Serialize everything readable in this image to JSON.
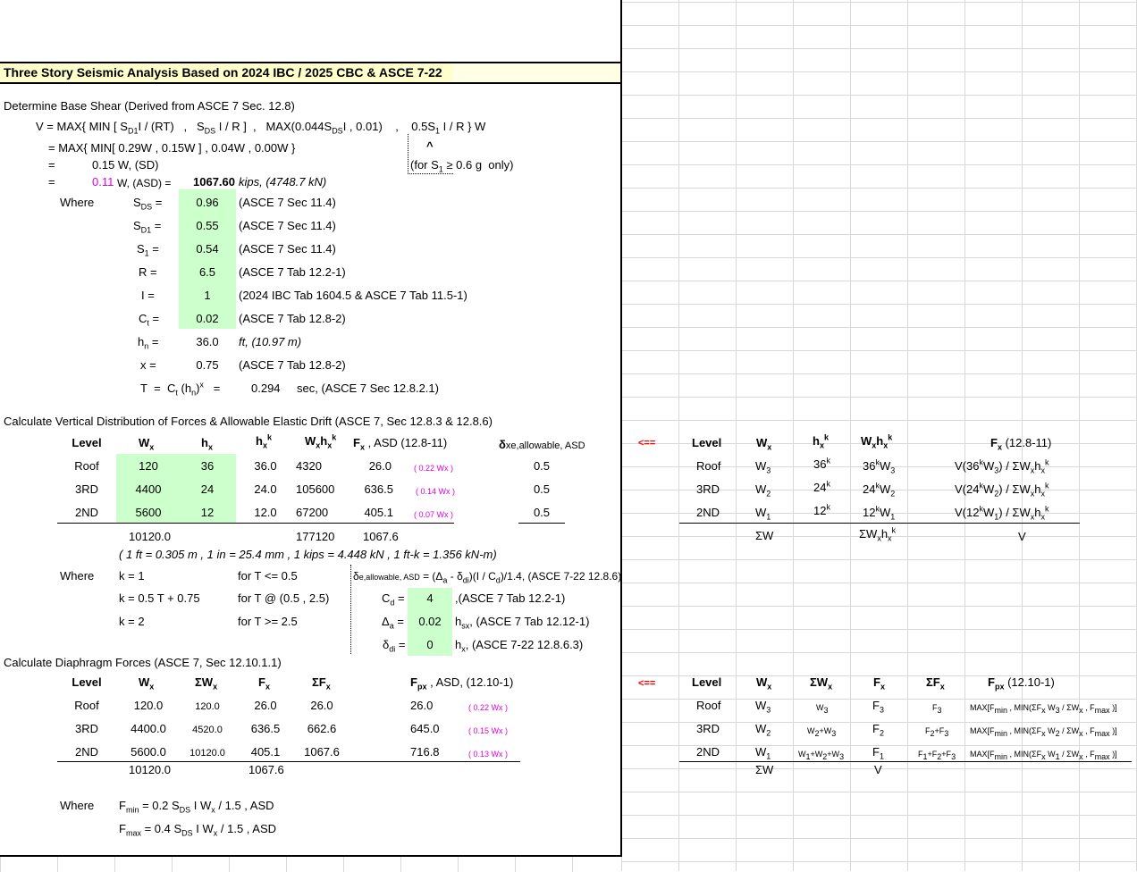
{
  "title": "Three Story Seismic Analysis Based on 2024 IBC / 2025 CBC & ASCE 7-22",
  "base_shear": {
    "heading": "Determine Base Shear (Derived from ASCE 7 Sec. 12.8)",
    "line1_prefix": "V = MAX{ MIN [ S",
    "line2": "= MAX{ MIN[ 0.29W  ,  0.15W ] ,  0.04W  ,  0.00W }",
    "caret": "^",
    "for_s1": "(for S",
    "for_s1_tail": " ≥ 0.6 g  only)",
    "eq": "=",
    "sd_value": "0.15 W, (SD)",
    "asd_coef": "0.11",
    "asd_label": "W, (ASD) =",
    "asd_value": "1067.60",
    "asd_units": "kips, (4748.7 kN)",
    "where": "Where"
  },
  "params": [
    {
      "sym": "S",
      "sub": "DS",
      "value": "0.96",
      "ref": "(ASCE 7 Sec 11.4)"
    },
    {
      "sym": "S",
      "sub": "D1",
      "value": "0.55",
      "ref": "(ASCE 7 Sec 11.4)"
    },
    {
      "sym": "S",
      "sub": "1",
      "value": "0.54",
      "ref": "(ASCE 7 Sec 11.4)"
    },
    {
      "sym": "R",
      "sub": "",
      "value": "6.5",
      "ref": "(ASCE 7 Tab 12.2-1)"
    },
    {
      "sym": "I",
      "sub": "",
      "value": "1",
      "ref": "(2024 IBC Tab 1604.5 & ASCE 7 Tab 11.5-1)"
    },
    {
      "sym": "C",
      "sub": "t",
      "value": "0.02",
      "ref": "(ASCE 7 Tab 12.8-2)"
    },
    {
      "sym": "h",
      "sub": "n",
      "value": "36.0",
      "ref": "ft, (10.97 m)"
    },
    {
      "sym": "x",
      "sub": "",
      "value": "0.75",
      "ref": "(ASCE 7 Tab 12.8-2)"
    }
  ],
  "period": {
    "label": "T  =  C",
    "value": "0.294",
    "ref": "sec, (ASCE 7 Sec 12.8.2.1)"
  },
  "vertical": {
    "heading": "Calculate Vertical Distribution of Forces & Allowable Elastic Drift (ASCE 7, Sec 12.8.3 & 12.8.6)",
    "headers": {
      "level": "Level",
      "fx_tail": " , ASD (12.8-11)",
      "drift_tail": "xe,allowable, ASD"
    },
    "rows": [
      {
        "level": "Roof",
        "wx": "120",
        "hx": "36",
        "hxk": "36.0",
        "wxhxk": "4320",
        "fx": "26.0",
        "pct": "( 0.22 Wx )",
        "drift": "0.5"
      },
      {
        "level": "3RD",
        "wx": "4400",
        "hx": "24",
        "hxk": "24.0",
        "wxhxk": "105600",
        "fx": "636.5",
        "pct": "( 0.14 Wx )",
        "drift": "0.5"
      },
      {
        "level": "2ND",
        "wx": "5600",
        "hx": "12",
        "hxk": "12.0",
        "wxhxk": "67200",
        "fx": "405.1",
        "pct": "( 0.07 Wx )",
        "drift": "0.5"
      }
    ],
    "totals": {
      "wx": "10120.0",
      "wxhxk": "177120",
      "fx": "1067.6"
    },
    "conversion": "( 1 ft = 0.305 m ,  1 in = 25.4 mm ,  1 kips = 4.448 kN ,  1 ft-k = 1.356 kN-m)",
    "where": "Where",
    "k_rules": [
      {
        "k": "k  =  1",
        "cond": "for T <= 0.5"
      },
      {
        "k": "k  =  0.5 T + 0.75",
        "cond": "for T @ (0.5 , 2.5)"
      },
      {
        "k": "k  =  2",
        "cond": "for T >= 2.5"
      }
    ],
    "drift_formula_tail": "= (Δa - δdi)(I / Cd)/1.4, (ASCE 7-22 12.8.6)",
    "drift_params": [
      {
        "value": "4",
        "ref": ",(ASCE 7 Tab 12.2-1)"
      },
      {
        "value": "0.02",
        "ref": ", (ASCE 7 Tab 12.12-1)"
      },
      {
        "value": "0",
        "ref": ", (ASCE 7-22 12.8.6.3)"
      }
    ]
  },
  "diaphragm": {
    "heading": "Calculate Diaphragm Forces (ASCE 7, Sec 12.10.1.1)",
    "fpx_tail": " , ASD, (12.10-1)",
    "rows": [
      {
        "level": "Roof",
        "wx": "120.0",
        "swx": "120.0",
        "fx": "26.0",
        "sfx": "26.0",
        "fpx": "26.0",
        "pct": "( 0.22 Wx )"
      },
      {
        "level": "3RD",
        "wx": "4400.0",
        "swx": "4520.0",
        "fx": "636.5",
        "sfx": "662.6",
        "fpx": "645.0",
        "pct": "( 0.15 Wx )"
      },
      {
        "level": "2ND",
        "wx": "5600.0",
        "swx": "10120.0",
        "fx": "405.1",
        "sfx": "1067.6",
        "fpx": "716.8",
        "pct": "( 0.13 Wx )"
      }
    ],
    "totals": {
      "wx": "10120.0",
      "fx": "1067.6"
    },
    "where": "Where",
    "fmin_tail": " I W",
    "fmin_end": " / 1.5 , ASD",
    "fmin_coef": "= 0.2 S",
    "fmax_coef": "= 0.4 S"
  },
  "side": {
    "arrow": "<==",
    "vertical_rows": [
      {
        "level": "Roof",
        "w": "3",
        "h": "36",
        "f": "V(36"
      },
      {
        "level": "3RD",
        "w": "2",
        "h": "24",
        "f": "V(24"
      },
      {
        "level": "2ND",
        "w": "1",
        "h": "12",
        "f": "V(12"
      }
    ],
    "diaphragm_rows": [
      {
        "level": "Roof",
        "w": "3",
        "sw": "W3",
        "f": "3",
        "sf": "F3",
        "fpx_w": "3"
      },
      {
        "level": "3RD",
        "w": "2",
        "sw": "W2+W3",
        "f": "2",
        "sf": "F2+F3",
        "fpx_w": "2"
      },
      {
        "level": "2ND",
        "w": "1",
        "sw": "W1+W2+W3",
        "f": "1",
        "sf": "F1+F2+F3",
        "fpx_w": "1"
      }
    ],
    "sum_w": "ΣW",
    "v": "V"
  }
}
